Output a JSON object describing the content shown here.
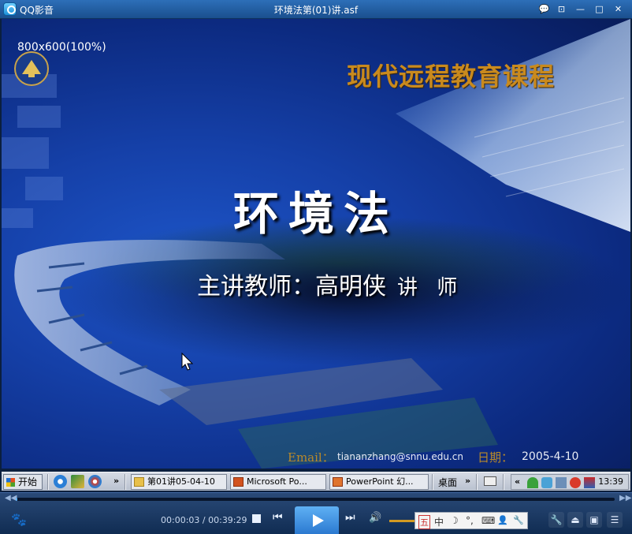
{
  "window": {
    "app_name": "QQ影音",
    "title": "环境法第(01)讲.asf",
    "buttons": {
      "chat": "💬",
      "skin": "⊡",
      "minimize": "—",
      "maximize": "□",
      "close": "✕"
    }
  },
  "video": {
    "resolution": "800x600(100%)",
    "course": "现代远程教育课程",
    "main_title": "环境法",
    "teacher_label": "主讲教师：高明侠",
    "teacher_role": "讲 师",
    "email_label": "Email：",
    "email": "tiananzhang@snnu.edu.cn",
    "date_label": "日期：",
    "date": "2005-4-10"
  },
  "taskbar": {
    "start": "开始",
    "chevron": "»",
    "tasks": [
      {
        "label": "第01讲05-04-10",
        "icon": "folder-icon"
      },
      {
        "label": "Microsoft Po...",
        "icon": "powerpoint-icon"
      },
      {
        "label": "PowerPoint 幻...",
        "icon": "powerpoint-slideshow-icon"
      }
    ],
    "desktop": "桌面",
    "tray_chevron": "«",
    "clock": "13:39"
  },
  "player": {
    "current_time": "00:00:03",
    "total_time": "00:39:29",
    "time_separator": " / ",
    "progress_fraction": 0.002,
    "accent": "#2a78cf",
    "ime": {
      "mode": "五",
      "lang": "中",
      "moon": "☽",
      "punct": "°,",
      "keyboard": "⌨",
      "person": "👤",
      "tool": "🔧"
    }
  }
}
